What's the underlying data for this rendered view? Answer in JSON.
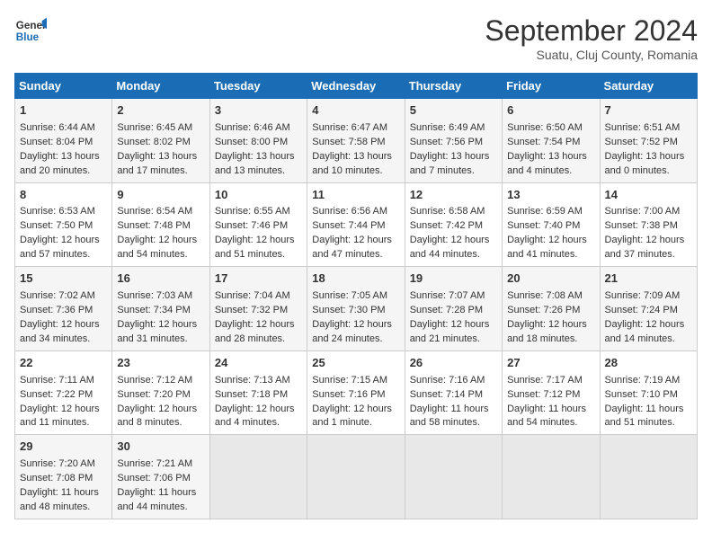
{
  "logo": {
    "line1": "General",
    "line2": "Blue"
  },
  "title": "September 2024",
  "subtitle": "Suatu, Cluj County, Romania",
  "headers": [
    "Sunday",
    "Monday",
    "Tuesday",
    "Wednesday",
    "Thursday",
    "Friday",
    "Saturday"
  ],
  "weeks": [
    [
      {
        "day": "1",
        "lines": [
          "Sunrise: 6:44 AM",
          "Sunset: 8:04 PM",
          "Daylight: 13 hours",
          "and 20 minutes."
        ]
      },
      {
        "day": "2",
        "lines": [
          "Sunrise: 6:45 AM",
          "Sunset: 8:02 PM",
          "Daylight: 13 hours",
          "and 17 minutes."
        ]
      },
      {
        "day": "3",
        "lines": [
          "Sunrise: 6:46 AM",
          "Sunset: 8:00 PM",
          "Daylight: 13 hours",
          "and 13 minutes."
        ]
      },
      {
        "day": "4",
        "lines": [
          "Sunrise: 6:47 AM",
          "Sunset: 7:58 PM",
          "Daylight: 13 hours",
          "and 10 minutes."
        ]
      },
      {
        "day": "5",
        "lines": [
          "Sunrise: 6:49 AM",
          "Sunset: 7:56 PM",
          "Daylight: 13 hours",
          "and 7 minutes."
        ]
      },
      {
        "day": "6",
        "lines": [
          "Sunrise: 6:50 AM",
          "Sunset: 7:54 PM",
          "Daylight: 13 hours",
          "and 4 minutes."
        ]
      },
      {
        "day": "7",
        "lines": [
          "Sunrise: 6:51 AM",
          "Sunset: 7:52 PM",
          "Daylight: 13 hours",
          "and 0 minutes."
        ]
      }
    ],
    [
      {
        "day": "8",
        "lines": [
          "Sunrise: 6:53 AM",
          "Sunset: 7:50 PM",
          "Daylight: 12 hours",
          "and 57 minutes."
        ]
      },
      {
        "day": "9",
        "lines": [
          "Sunrise: 6:54 AM",
          "Sunset: 7:48 PM",
          "Daylight: 12 hours",
          "and 54 minutes."
        ]
      },
      {
        "day": "10",
        "lines": [
          "Sunrise: 6:55 AM",
          "Sunset: 7:46 PM",
          "Daylight: 12 hours",
          "and 51 minutes."
        ]
      },
      {
        "day": "11",
        "lines": [
          "Sunrise: 6:56 AM",
          "Sunset: 7:44 PM",
          "Daylight: 12 hours",
          "and 47 minutes."
        ]
      },
      {
        "day": "12",
        "lines": [
          "Sunrise: 6:58 AM",
          "Sunset: 7:42 PM",
          "Daylight: 12 hours",
          "and 44 minutes."
        ]
      },
      {
        "day": "13",
        "lines": [
          "Sunrise: 6:59 AM",
          "Sunset: 7:40 PM",
          "Daylight: 12 hours",
          "and 41 minutes."
        ]
      },
      {
        "day": "14",
        "lines": [
          "Sunrise: 7:00 AM",
          "Sunset: 7:38 PM",
          "Daylight: 12 hours",
          "and 37 minutes."
        ]
      }
    ],
    [
      {
        "day": "15",
        "lines": [
          "Sunrise: 7:02 AM",
          "Sunset: 7:36 PM",
          "Daylight: 12 hours",
          "and 34 minutes."
        ]
      },
      {
        "day": "16",
        "lines": [
          "Sunrise: 7:03 AM",
          "Sunset: 7:34 PM",
          "Daylight: 12 hours",
          "and 31 minutes."
        ]
      },
      {
        "day": "17",
        "lines": [
          "Sunrise: 7:04 AM",
          "Sunset: 7:32 PM",
          "Daylight: 12 hours",
          "and 28 minutes."
        ]
      },
      {
        "day": "18",
        "lines": [
          "Sunrise: 7:05 AM",
          "Sunset: 7:30 PM",
          "Daylight: 12 hours",
          "and 24 minutes."
        ]
      },
      {
        "day": "19",
        "lines": [
          "Sunrise: 7:07 AM",
          "Sunset: 7:28 PM",
          "Daylight: 12 hours",
          "and 21 minutes."
        ]
      },
      {
        "day": "20",
        "lines": [
          "Sunrise: 7:08 AM",
          "Sunset: 7:26 PM",
          "Daylight: 12 hours",
          "and 18 minutes."
        ]
      },
      {
        "day": "21",
        "lines": [
          "Sunrise: 7:09 AM",
          "Sunset: 7:24 PM",
          "Daylight: 12 hours",
          "and 14 minutes."
        ]
      }
    ],
    [
      {
        "day": "22",
        "lines": [
          "Sunrise: 7:11 AM",
          "Sunset: 7:22 PM",
          "Daylight: 12 hours",
          "and 11 minutes."
        ]
      },
      {
        "day": "23",
        "lines": [
          "Sunrise: 7:12 AM",
          "Sunset: 7:20 PM",
          "Daylight: 12 hours",
          "and 8 minutes."
        ]
      },
      {
        "day": "24",
        "lines": [
          "Sunrise: 7:13 AM",
          "Sunset: 7:18 PM",
          "Daylight: 12 hours",
          "and 4 minutes."
        ]
      },
      {
        "day": "25",
        "lines": [
          "Sunrise: 7:15 AM",
          "Sunset: 7:16 PM",
          "Daylight: 12 hours",
          "and 1 minute."
        ]
      },
      {
        "day": "26",
        "lines": [
          "Sunrise: 7:16 AM",
          "Sunset: 7:14 PM",
          "Daylight: 11 hours",
          "and 58 minutes."
        ]
      },
      {
        "day": "27",
        "lines": [
          "Sunrise: 7:17 AM",
          "Sunset: 7:12 PM",
          "Daylight: 11 hours",
          "and 54 minutes."
        ]
      },
      {
        "day": "28",
        "lines": [
          "Sunrise: 7:19 AM",
          "Sunset: 7:10 PM",
          "Daylight: 11 hours",
          "and 51 minutes."
        ]
      }
    ],
    [
      {
        "day": "29",
        "lines": [
          "Sunrise: 7:20 AM",
          "Sunset: 7:08 PM",
          "Daylight: 11 hours",
          "and 48 minutes."
        ]
      },
      {
        "day": "30",
        "lines": [
          "Sunrise: 7:21 AM",
          "Sunset: 7:06 PM",
          "Daylight: 11 hours",
          "and 44 minutes."
        ]
      },
      {
        "day": "",
        "lines": []
      },
      {
        "day": "",
        "lines": []
      },
      {
        "day": "",
        "lines": []
      },
      {
        "day": "",
        "lines": []
      },
      {
        "day": "",
        "lines": []
      }
    ]
  ]
}
